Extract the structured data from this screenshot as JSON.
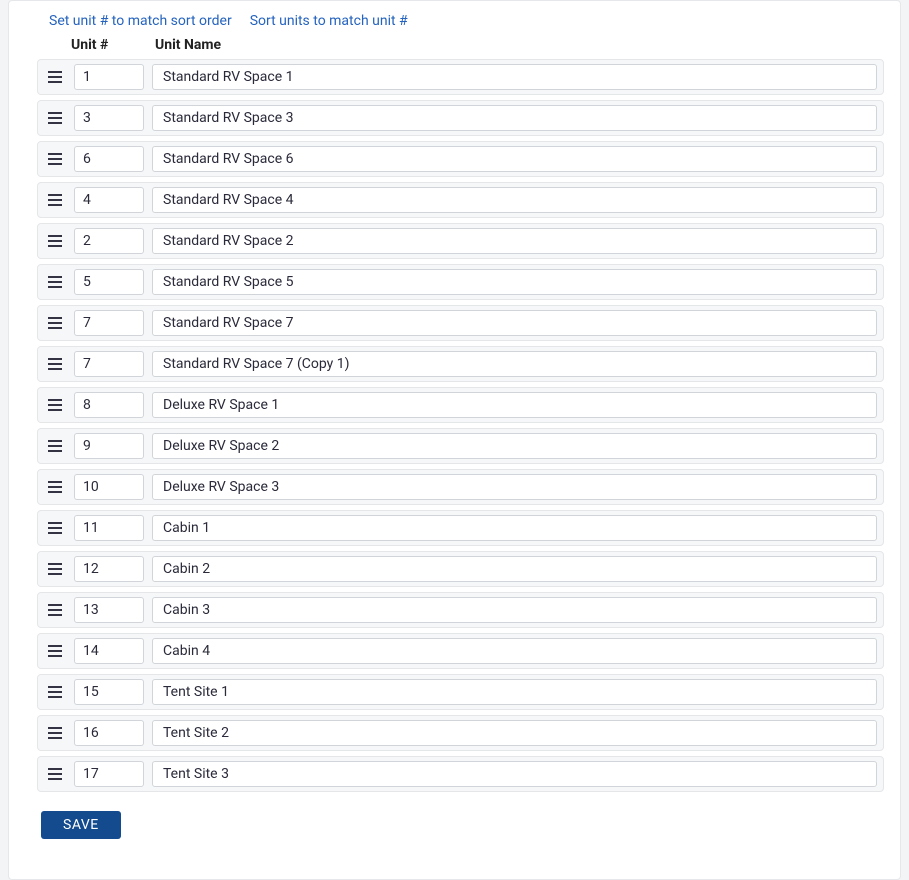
{
  "links": {
    "set_unit_number": "Set unit # to match sort order",
    "sort_units": "Sort units to match unit #"
  },
  "headers": {
    "unit_number": "Unit #",
    "unit_name": "Unit Name"
  },
  "units": [
    {
      "number": "1",
      "name": "Standard RV Space 1"
    },
    {
      "number": "3",
      "name": "Standard RV Space 3"
    },
    {
      "number": "6",
      "name": "Standard RV Space 6"
    },
    {
      "number": "4",
      "name": "Standard RV Space 4"
    },
    {
      "number": "2",
      "name": "Standard RV Space 2"
    },
    {
      "number": "5",
      "name": "Standard RV Space 5"
    },
    {
      "number": "7",
      "name": "Standard RV Space 7"
    },
    {
      "number": "7",
      "name": "Standard RV Space 7 (Copy 1)"
    },
    {
      "number": "8",
      "name": "Deluxe RV Space 1"
    },
    {
      "number": "9",
      "name": "Deluxe RV Space 2"
    },
    {
      "number": "10",
      "name": "Deluxe RV Space 3"
    },
    {
      "number": "11",
      "name": "Cabin 1"
    },
    {
      "number": "12",
      "name": "Cabin 2"
    },
    {
      "number": "13",
      "name": "Cabin 3"
    },
    {
      "number": "14",
      "name": "Cabin 4"
    },
    {
      "number": "15",
      "name": "Tent Site 1"
    },
    {
      "number": "16",
      "name": "Tent Site 2"
    },
    {
      "number": "17",
      "name": "Tent Site 3"
    }
  ],
  "buttons": {
    "save": "SAVE"
  }
}
